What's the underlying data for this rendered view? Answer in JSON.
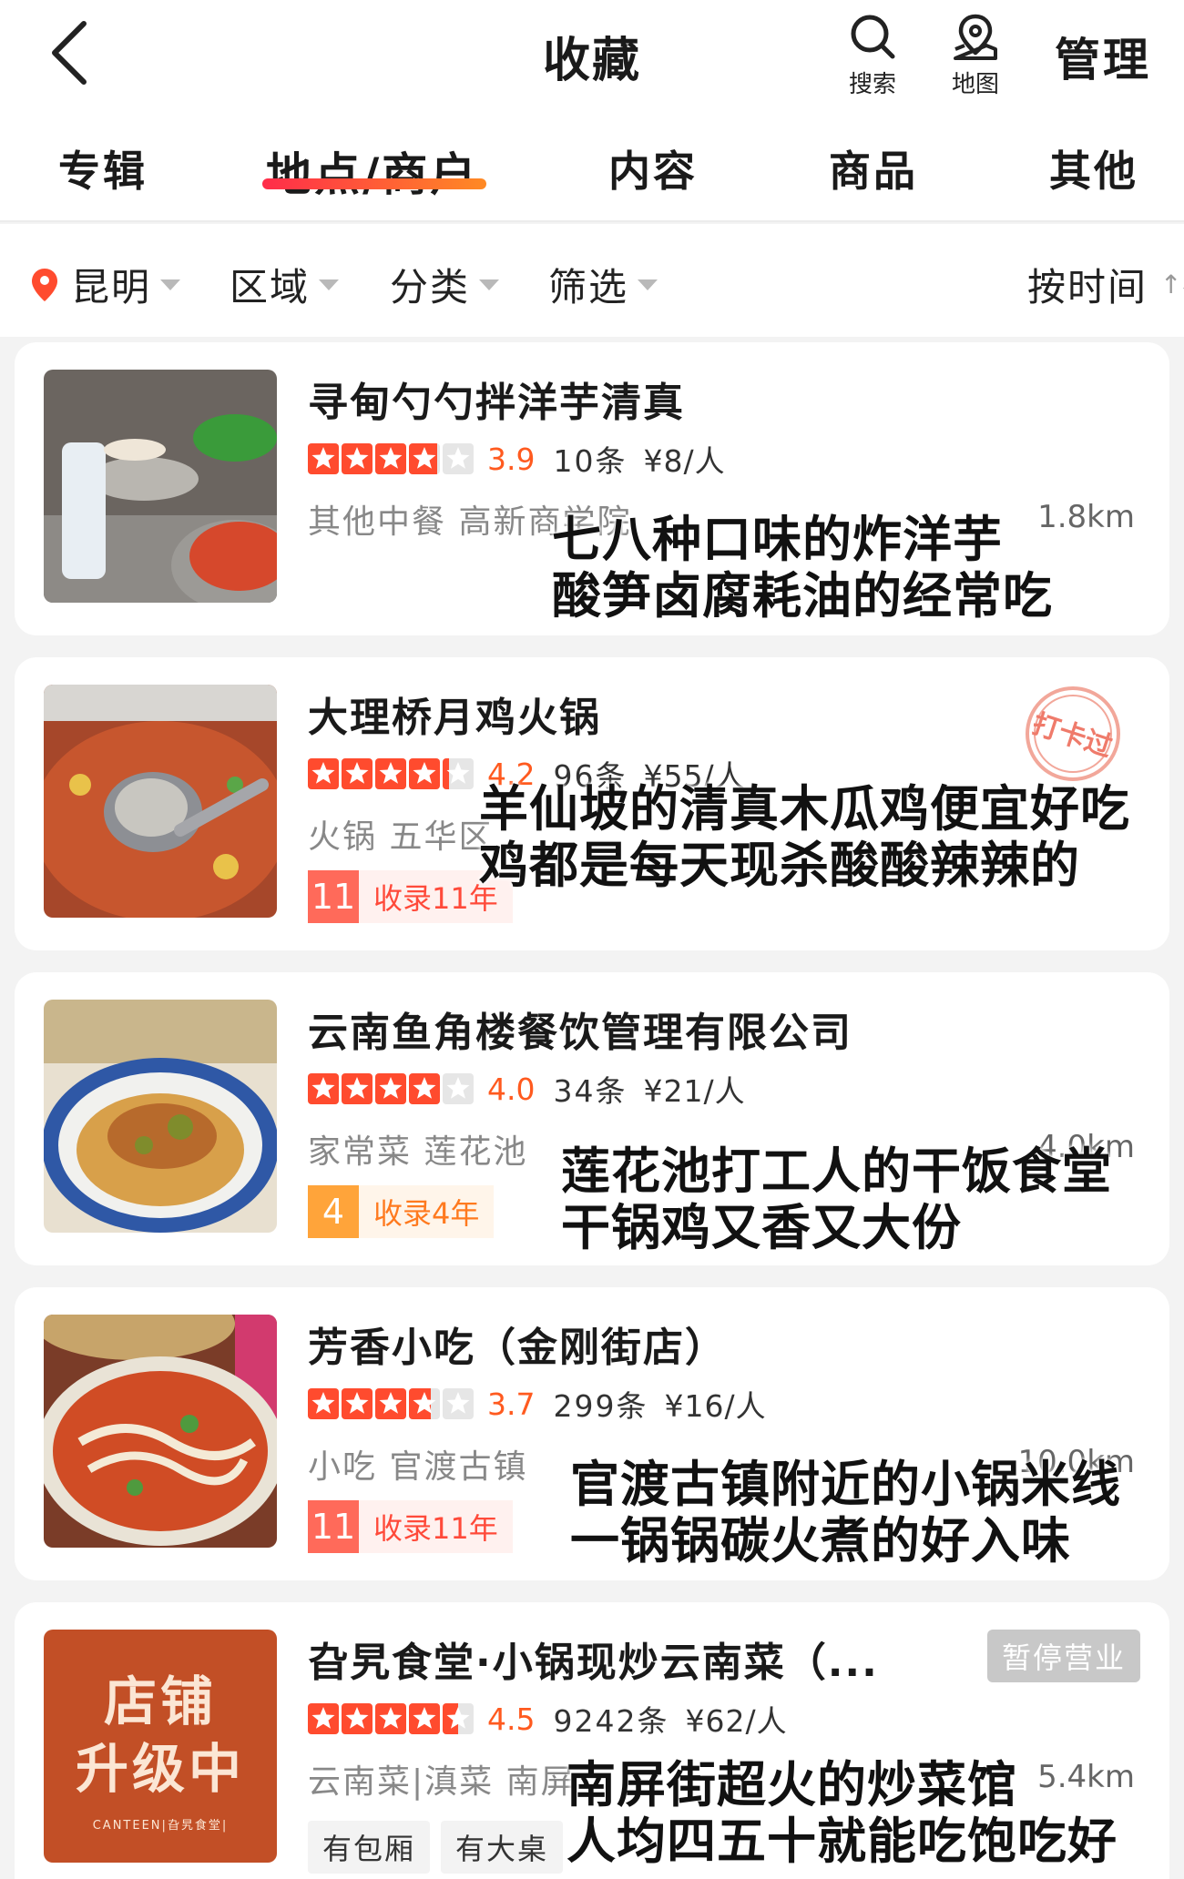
{
  "header": {
    "title": "收藏",
    "search_label": "搜索",
    "map_label": "地图",
    "manage_label": "管理"
  },
  "tabs": [
    {
      "label": "专辑",
      "active": false
    },
    {
      "label": "地点/商户",
      "active": true
    },
    {
      "label": "内容",
      "active": false
    },
    {
      "label": "商品",
      "active": false
    },
    {
      "label": "其他",
      "active": false
    }
  ],
  "filters": {
    "city": "昆明",
    "area": "区域",
    "category": "分类",
    "screen": "筛选",
    "sort": "按时间"
  },
  "colors": {
    "accent": "#ff4b2e",
    "tab_underline_start": "#ff2c4a",
    "tab_underline_end": "#ff8a24",
    "pin": "#ff4b2e"
  },
  "cards": [
    {
      "name": "寻甸勺勺拌洋芋清真",
      "rating": 3.9,
      "score": "3.9",
      "reviews": "10条",
      "price": "¥8/人",
      "meta": "其他中餐 高新商学院",
      "distance": "1.8km",
      "note_lines": [
        "七八种口味的炸洋芋",
        "酸笋卤腐耗油的经常吃"
      ]
    },
    {
      "name": "大理桥月鸡火锅",
      "rating": 4.2,
      "score": "4.2",
      "reviews": "96条",
      "price": "¥55/人",
      "meta": "火锅 五华区",
      "distance": "",
      "collect_num": "11",
      "collect_text": "收录11年",
      "stamp": "打卡过",
      "note_lines": [
        "羊仙坡的清真木瓜鸡便宜好吃",
        "鸡都是每天现杀酸酸辣辣的"
      ]
    },
    {
      "name": "云南鱼角楼餐饮管理有限公司",
      "rating": 4.0,
      "score": "4.0",
      "reviews": "34条",
      "price": "¥21/人",
      "meta": "家常菜 莲花池",
      "distance": "4.0km",
      "collect_num": "4",
      "collect_text": "收录4年",
      "note_lines": [
        "莲花池打工人的干饭食堂",
        "干锅鸡又香又大份"
      ]
    },
    {
      "name": "芳香小吃（金刚街店）",
      "rating": 3.7,
      "score": "3.7",
      "reviews": "299条",
      "price": "¥16/人",
      "meta": "小吃 官渡古镇",
      "distance": "10.0km",
      "collect_num": "11",
      "collect_text": "收录11年",
      "note_lines": [
        "官渡古镇附近的小锅米线",
        "一锅锅碳火煮的好入味"
      ]
    },
    {
      "name": "旮旯食堂·小锅现炒云南菜（...",
      "rating": 4.5,
      "score": "4.5",
      "reviews": "9242条",
      "price": "¥62/人",
      "meta": "云南菜|滇菜 南屏",
      "distance": "5.4km",
      "closed_badge": "暂停营业",
      "tags": [
        "有包厢",
        "有大桌"
      ],
      "thumb_lines": [
        "店铺",
        "升级中"
      ],
      "thumb_footer": "CANTEEN|旮旯食堂|",
      "note_lines": [
        "南屏街超火的炒菜馆",
        "人均四五十就能吃饱吃好"
      ]
    }
  ]
}
